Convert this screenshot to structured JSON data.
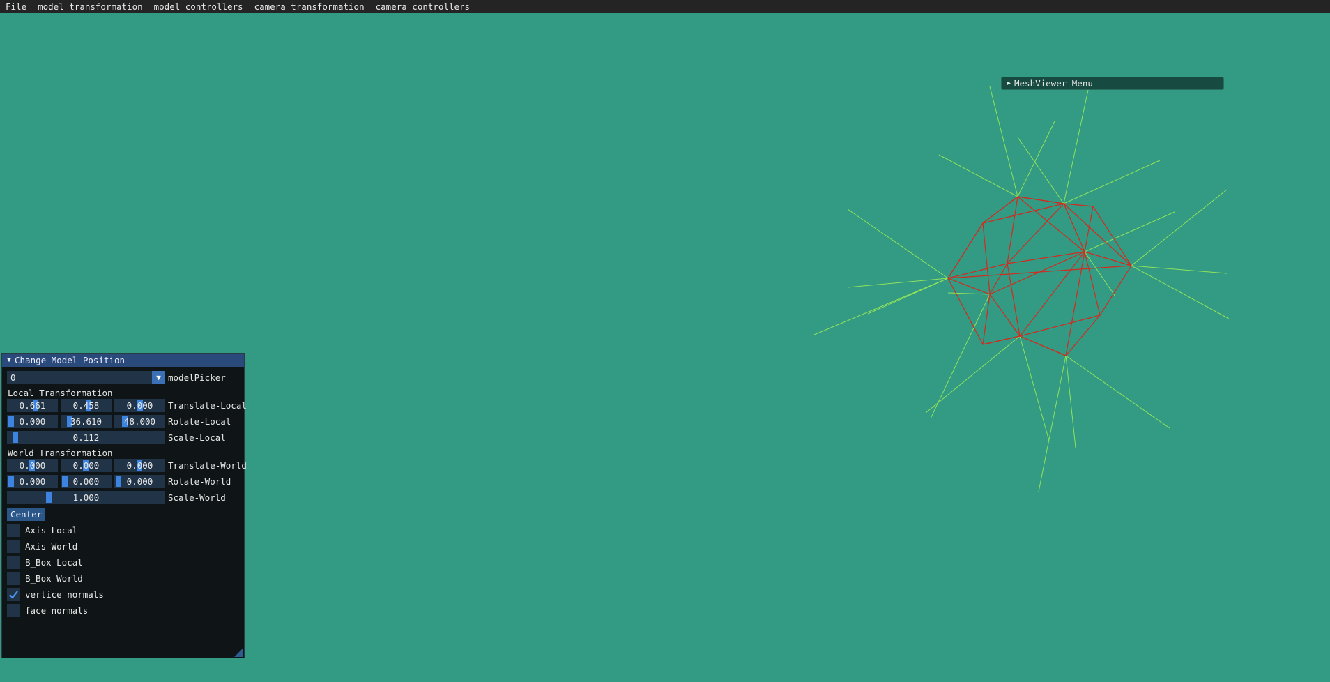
{
  "menubar": {
    "items": [
      "File",
      "model transformation",
      "model controllers",
      "camera transformation",
      "camera controllers"
    ]
  },
  "meshviewer": {
    "title": "MeshViewer Menu",
    "icon": "collapsed-triangle-icon"
  },
  "panel": {
    "title": "Change Model Position",
    "model_picker": {
      "value": "0",
      "label": "modelPicker"
    },
    "local_section": "Local Transformation",
    "translate_local": {
      "values": [
        "0.661",
        "0.458",
        "0.000"
      ],
      "label": "Translate-Local"
    },
    "rotate_local": {
      "values": [
        "0.000",
        "36.610",
        "48.000"
      ],
      "label": "Rotate-Local"
    },
    "scale_local": {
      "value": "0.112",
      "label": "Scale-Local"
    },
    "world_section": "World Transformation",
    "translate_world": {
      "values": [
        "0.000",
        "0.000",
        "0.000"
      ],
      "label": "Translate-World"
    },
    "rotate_world": {
      "values": [
        "0.000",
        "0.000",
        "0.000"
      ],
      "label": "Rotate-World"
    },
    "scale_world": {
      "value": "1.000",
      "label": "Scale-World"
    },
    "center_button": "Center",
    "checkboxes": [
      {
        "label": "Axis Local",
        "checked": false
      },
      {
        "label": "Axis World",
        "checked": false
      },
      {
        "label": "B_Box Local",
        "checked": false
      },
      {
        "label": "B_Box World",
        "checked": false
      },
      {
        "label": "vertice normals",
        "checked": true
      },
      {
        "label": "face normals",
        "checked": false
      }
    ]
  },
  "colors": {
    "background": "#339a83",
    "mesh_edges": "#d42a1e",
    "vertex_normals": "#8fe35a",
    "accent": "#3d84e0"
  }
}
